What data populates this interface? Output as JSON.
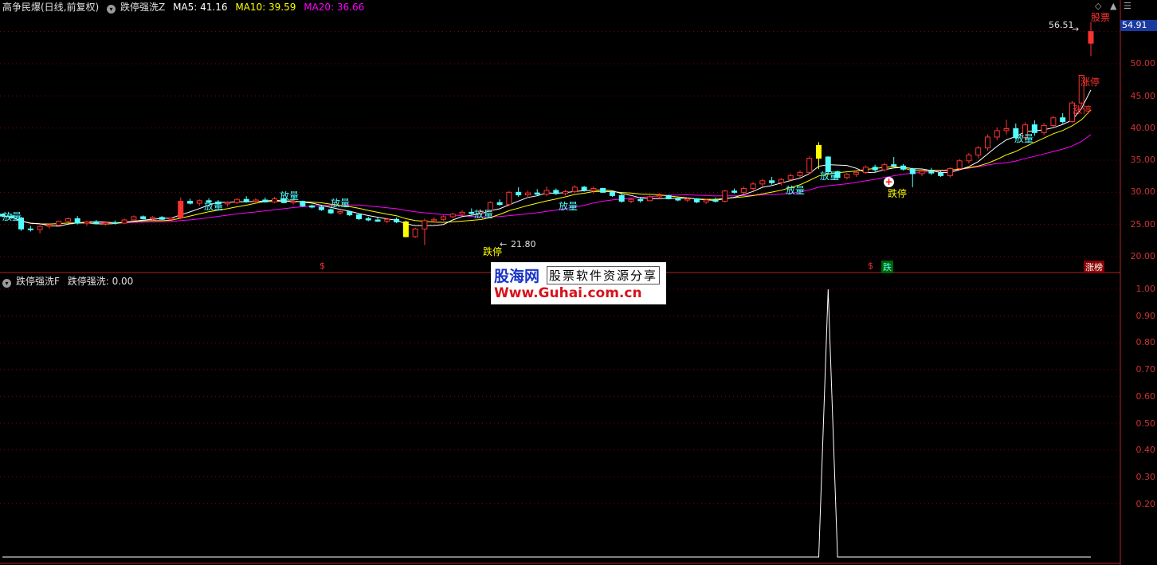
{
  "header": {
    "main_title": "高争民爆(日线,前复权)",
    "indicator_name": "跌停强洗Z",
    "ma5_label": "MA5: 41.16",
    "ma10_label": "MA10: 39.59",
    "ma20_label": "MA20: 36.66",
    "sub_indicator": "跌停强洗F",
    "sub_value": "跌停强洗: 0.00"
  },
  "colors": {
    "background": "#000000",
    "up": "#ff3232",
    "down": "#54ffff",
    "ma5": "#ffffff",
    "ma10": "#ffff00",
    "ma20": "#ff00ff",
    "grid": "#8b0000",
    "label_cyan": "#54ffff",
    "label_red": "#ff3232",
    "label_yellow": "#ffff00",
    "price_tag": "#1a3aa0"
  },
  "price_axis": [
    "50.00",
    "45.00",
    "40.00",
    "35.00",
    "30.00",
    "25.00",
    "20.00"
  ],
  "current_price": "54.91",
  "sub_axis": [
    "1.00",
    "0.90",
    "0.80",
    "0.70",
    "0.60",
    "0.50",
    "0.40",
    "0.30",
    "0.20"
  ],
  "annotations": {
    "fangliang": "放量",
    "dieting": "跌停",
    "zhangting": "涨停",
    "high_price": "56.51",
    "low_price": "21.80",
    "top_right_label": "股票",
    "bottom_row_s": "$",
    "bottom_row_die": "跌",
    "bottom_row_zhang": "涨榜"
  },
  "watermark": {
    "brand": "股海网",
    "subtitle": "股票软件资源分享",
    "url": "Www.Guhai.com.cn"
  },
  "chart_data": [
    {
      "type": "candlestick",
      "title": "高争民爆(日线,前复权)",
      "ylim": [
        19,
        57
      ],
      "ma_legend": [
        "MA5: 41.16",
        "MA10: 39.59",
        "MA20: 36.66"
      ],
      "candles": [
        [
          26.6,
          26.7,
          26.1,
          26.3
        ],
        [
          26.3,
          26.6,
          25.9,
          26.0
        ],
        [
          26.0,
          26.2,
          24.0,
          24.3
        ],
        [
          24.3,
          24.8,
          23.9,
          24.2
        ],
        [
          24.2,
          24.9,
          23.6,
          24.7
        ],
        [
          24.7,
          25.1,
          24.4,
          24.9
        ],
        [
          24.9,
          25.6,
          24.7,
          25.5
        ],
        [
          25.5,
          26.1,
          25.3,
          25.9
        ],
        [
          25.9,
          26.3,
          25.0,
          25.2
        ],
        [
          25.2,
          25.6,
          24.8,
          25.4
        ],
        [
          25.4,
          25.7,
          25.0,
          25.1
        ],
        [
          25.1,
          25.5,
          24.8,
          25.3
        ],
        [
          25.3,
          25.6,
          25.0,
          25.2
        ],
        [
          25.2,
          25.9,
          25.1,
          25.7
        ],
        [
          25.7,
          26.4,
          25.5,
          26.2
        ],
        [
          26.2,
          26.4,
          25.8,
          25.9
        ],
        [
          25.9,
          26.3,
          25.6,
          26.1
        ],
        [
          26.1,
          26.3,
          25.7,
          25.8
        ],
        [
          25.8,
          26.1,
          25.5,
          26.0
        ],
        [
          26.0,
          29.2,
          25.8,
          28.6
        ],
        [
          28.6,
          29.0,
          28.1,
          28.3
        ],
        [
          28.3,
          28.9,
          27.9,
          28.7
        ],
        [
          28.7,
          29.1,
          28.3,
          28.5
        ],
        [
          28.5,
          28.8,
          28.0,
          28.2
        ],
        [
          28.2,
          28.6,
          27.8,
          28.4
        ],
        [
          28.4,
          29.1,
          28.2,
          28.9
        ],
        [
          28.9,
          29.4,
          28.4,
          28.6
        ],
        [
          28.6,
          29.1,
          28.3,
          28.8
        ],
        [
          28.8,
          29.2,
          28.4,
          28.5
        ],
        [
          28.5,
          29.3,
          28.3,
          29.0
        ],
        [
          29.0,
          29.1,
          28.3,
          28.4
        ],
        [
          28.4,
          28.8,
          28.1,
          28.6
        ],
        [
          28.6,
          28.7,
          27.7,
          27.9
        ],
        [
          27.9,
          28.1,
          27.5,
          27.7
        ],
        [
          27.7,
          27.9,
          27.1,
          27.3
        ],
        [
          27.3,
          27.5,
          26.6,
          26.8
        ],
        [
          26.8,
          27.2,
          26.5,
          27.0
        ],
        [
          27.0,
          27.1,
          26.3,
          26.5
        ],
        [
          26.5,
          26.7,
          25.7,
          25.9
        ],
        [
          25.9,
          26.2,
          25.5,
          25.7
        ],
        [
          25.7,
          26.1,
          25.4,
          25.5
        ],
        [
          25.5,
          26.0,
          25.2,
          25.8
        ],
        [
          25.8,
          26.1,
          25.2,
          25.4
        ],
        [
          25.4,
          25.6,
          23.0,
          23.1
        ],
        [
          23.1,
          24.5,
          22.9,
          24.3
        ],
        [
          24.3,
          25.9,
          21.8,
          25.6
        ],
        [
          25.6,
          26.1,
          25.3,
          25.8
        ],
        [
          25.8,
          26.4,
          25.6,
          26.2
        ],
        [
          26.2,
          26.8,
          26.0,
          26.6
        ],
        [
          26.6,
          27.2,
          26.3,
          26.9
        ],
        [
          26.9,
          27.5,
          26.5,
          26.7
        ],
        [
          26.7,
          27.3,
          26.4,
          27.1
        ],
        [
          27.1,
          28.6,
          26.9,
          28.4
        ],
        [
          28.4,
          28.9,
          27.9,
          28.1
        ],
        [
          28.1,
          30.2,
          27.9,
          30.0
        ],
        [
          30.0,
          30.8,
          29.3,
          29.6
        ],
        [
          29.6,
          30.3,
          29.1,
          29.9
        ],
        [
          29.9,
          30.5,
          29.5,
          29.7
        ],
        [
          29.7,
          30.9,
          29.4,
          30.3
        ],
        [
          30.3,
          30.6,
          29.6,
          29.8
        ],
        [
          29.8,
          30.4,
          29.5,
          30.1
        ],
        [
          30.1,
          31.1,
          29.9,
          30.8
        ],
        [
          30.8,
          31.0,
          30.1,
          30.3
        ],
        [
          30.3,
          30.9,
          29.8,
          30.6
        ],
        [
          30.6,
          30.7,
          29.9,
          30.0
        ],
        [
          30.0,
          30.2,
          29.3,
          29.5
        ],
        [
          29.5,
          29.8,
          28.4,
          28.6
        ],
        [
          28.6,
          29.1,
          28.3,
          28.9
        ],
        [
          28.9,
          29.3,
          28.4,
          28.7
        ],
        [
          28.7,
          29.5,
          28.6,
          29.3
        ],
        [
          29.3,
          29.9,
          29.0,
          29.5
        ],
        [
          29.5,
          29.6,
          28.9,
          29.0
        ],
        [
          29.0,
          29.3,
          28.6,
          28.8
        ],
        [
          28.8,
          29.2,
          28.5,
          29.0
        ],
        [
          29.0,
          29.1,
          28.3,
          28.5
        ],
        [
          28.5,
          29.0,
          28.2,
          28.8
        ],
        [
          28.8,
          29.2,
          28.4,
          28.6
        ],
        [
          28.6,
          30.4,
          28.4,
          30.2
        ],
        [
          30.2,
          30.6,
          29.8,
          30.0
        ],
        [
          30.0,
          30.9,
          29.7,
          30.6
        ],
        [
          30.6,
          31.6,
          30.3,
          31.3
        ],
        [
          31.3,
          32.1,
          30.9,
          31.8
        ],
        [
          31.8,
          32.4,
          31.2,
          31.5
        ],
        [
          31.5,
          32.2,
          31.1,
          32.0
        ],
        [
          32.0,
          32.9,
          31.7,
          32.6
        ],
        [
          32.6,
          33.4,
          32.2,
          33.1
        ],
        [
          33.1,
          35.6,
          32.8,
          35.3
        ],
        [
          35.3,
          37.8,
          33.6,
          37.3
        ],
        [
          35.5,
          35.6,
          33.0,
          33.2
        ],
        [
          33.2,
          33.4,
          32.0,
          32.3
        ],
        [
          32.3,
          33.0,
          32.0,
          32.8
        ],
        [
          32.8,
          33.5,
          32.4,
          33.1
        ],
        [
          33.1,
          34.2,
          32.9,
          33.9
        ],
        [
          33.9,
          34.3,
          33.2,
          33.5
        ],
        [
          33.5,
          34.6,
          33.2,
          34.3
        ],
        [
          34.3,
          35.5,
          33.9,
          34.1
        ],
        [
          34.1,
          34.4,
          33.4,
          33.6
        ],
        [
          33.6,
          33.8,
          30.8,
          32.9
        ],
        [
          32.9,
          33.6,
          32.5,
          33.3
        ],
        [
          33.3,
          33.8,
          32.7,
          33.0
        ],
        [
          33.0,
          33.4,
          32.4,
          32.6
        ],
        [
          32.6,
          33.9,
          32.3,
          33.7
        ],
        [
          33.7,
          35.2,
          33.4,
          34.9
        ],
        [
          34.9,
          36.1,
          34.5,
          35.8
        ],
        [
          35.8,
          37.2,
          35.3,
          36.9
        ],
        [
          36.9,
          39.0,
          36.5,
          38.6
        ],
        [
          38.6,
          40.1,
          38.1,
          39.6
        ],
        [
          39.6,
          41.3,
          39.0,
          39.9
        ],
        [
          39.9,
          40.7,
          38.2,
          38.5
        ],
        [
          38.5,
          40.9,
          38.0,
          40.5
        ],
        [
          40.5,
          41.2,
          38.8,
          39.3
        ],
        [
          39.3,
          40.8,
          38.9,
          40.4
        ],
        [
          40.4,
          41.9,
          40.1,
          41.6
        ],
        [
          41.6,
          42.3,
          40.7,
          41.0
        ],
        [
          41.0,
          44.2,
          40.8,
          43.9
        ],
        [
          43.9,
          48.3,
          43.5,
          48.2
        ],
        [
          53.2,
          56.5,
          51.2,
          55.0
        ]
      ]
    },
    {
      "type": "line",
      "title": "跌停强洗F",
      "ylim": [
        0,
        1
      ],
      "series": [
        {
          "name": "跌停强洗",
          "values": [
            0,
            0,
            0,
            0,
            0,
            0,
            0,
            0,
            0,
            0,
            0,
            0,
            0,
            0,
            0,
            0,
            0,
            0,
            0,
            0,
            0,
            0,
            0,
            0,
            0,
            0,
            0,
            0,
            0,
            0,
            0,
            0,
            0,
            0,
            0,
            0,
            0,
            0,
            0,
            0,
            0,
            0,
            0,
            0,
            0,
            0,
            0,
            0,
            0,
            0,
            0,
            0,
            0,
            0,
            0,
            0,
            0,
            0,
            0,
            0,
            0,
            0,
            0,
            0,
            0,
            0,
            0,
            0,
            0,
            0,
            0,
            0,
            0,
            0,
            0,
            0,
            0,
            0,
            0,
            0,
            0,
            0,
            0,
            0,
            0,
            0,
            0,
            0,
            1,
            0,
            0,
            0,
            0,
            0,
            0,
            0,
            0,
            0,
            0,
            0,
            0,
            0,
            0,
            0,
            0,
            0,
            0,
            0,
            0,
            0,
            0,
            0,
            0,
            0,
            0,
            0,
            0
          ]
        }
      ]
    }
  ]
}
